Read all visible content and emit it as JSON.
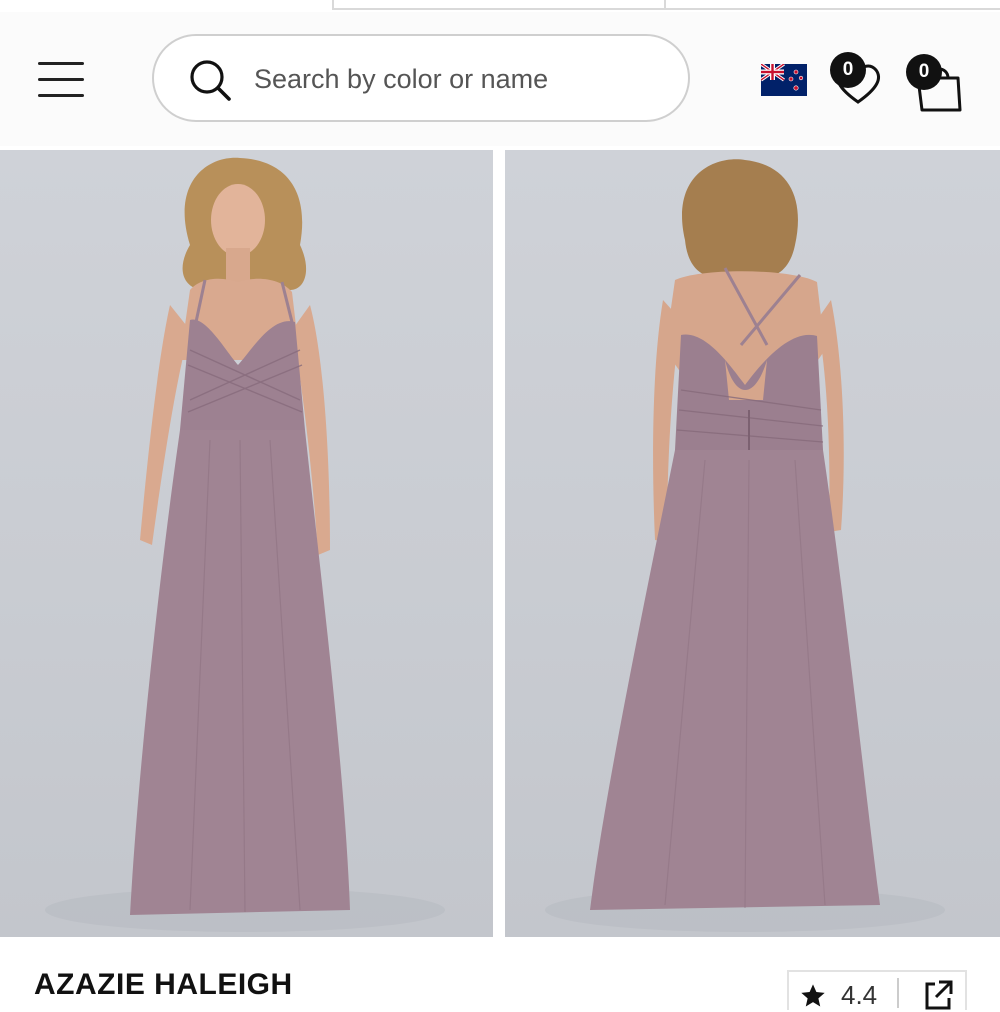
{
  "header": {
    "search": {
      "placeholder": "Search by color or name",
      "value": ""
    },
    "wishlist_count": "0",
    "cart_count": "0",
    "region_flag": "new-zealand-flag"
  },
  "gallery": {
    "images": [
      {
        "view": "front",
        "dress_color": "#9d8191"
      },
      {
        "view": "back",
        "dress_color": "#9d8191"
      }
    ]
  },
  "product": {
    "name": "AZAZIE HALEIGH",
    "rating": "4.4"
  },
  "colors": {
    "background": "#ffffff",
    "header_bg": "#fbfbfb",
    "photo_bg": "#cdd0d6",
    "dress": "#9d8191"
  },
  "icons": [
    "menu-icon",
    "search-icon",
    "new-zealand-flag",
    "heart-icon",
    "shopping-bag-icon",
    "star-icon",
    "share-icon"
  ]
}
